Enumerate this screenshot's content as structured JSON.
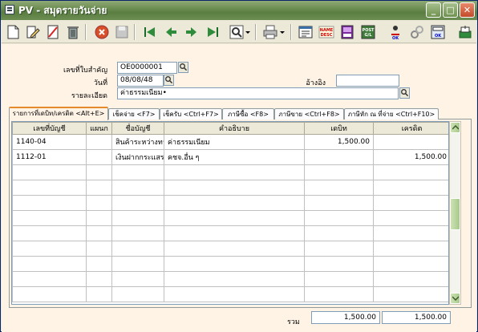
{
  "window": {
    "title": "PV - สมุดรายวันจ่าย"
  },
  "toolbar": {
    "tools": [
      "new-icon",
      "edit-icon",
      "cancel-doc-icon",
      "trash-icon",
      "stop-icon",
      "save-icon",
      "first-icon",
      "prev-icon",
      "next-icon",
      "last-icon",
      "find-icon",
      "dropdown-icon",
      "print-icon",
      "dropdown-icon",
      "memo-icon",
      "name-desc-icon",
      "purple-doc-icon",
      "post-gl-icon",
      "ok-icon",
      "tools-icon",
      "calc-ok-icon",
      "exit-icon"
    ],
    "name_desc_text": [
      "NAME",
      "DESC"
    ],
    "post_gl_text": [
      "POST",
      "G/L"
    ],
    "ok_text": "OK"
  },
  "header": {
    "doc_no_label": "เลขที่ใบสำคัญ",
    "doc_no_value": "OE0000001",
    "date_label": "วันที่",
    "date_value": "08/08/48",
    "ref_label": "อ้างอิง",
    "ref_value": "",
    "desc_label": "รายละเอียด",
    "desc_value": "ค่าธรรมเนียม•"
  },
  "tabs": [
    "รายการที่เดบิท/เครดิต <Alt+E>",
    "เช็คจ่าย <F7>",
    "เช็ครับ <Ctrl+F7>",
    "ภาษีซื้อ <F8>",
    "ภาษีขาย <Ctrl+F8>",
    "ภาษีหัก ณ ที่จ่าย <Ctrl+F10>"
  ],
  "grid": {
    "columns": [
      "เลขที่บัญชี",
      "แผนก",
      "ชื่อบัญชี",
      "คำอธิบาย",
      "เดบิท",
      "เครดิต"
    ],
    "rows": [
      [
        "1140-04",
        "",
        "สินค้าระหว่างทา",
        "ค่าธรรมเนียม",
        "1,500.00",
        ""
      ],
      [
        "1112-01",
        "",
        "เงินฝากกระแสร",
        "คชจ.อื่น ๆ",
        "",
        "1,500.00"
      ]
    ]
  },
  "totals": {
    "label": "รวม",
    "debit": "1,500.00",
    "credit": "1,500.00"
  },
  "colors": {
    "titlebar": "#6d8e52",
    "panel": "#fff3e6",
    "active_tab": "#e68b2c"
  }
}
